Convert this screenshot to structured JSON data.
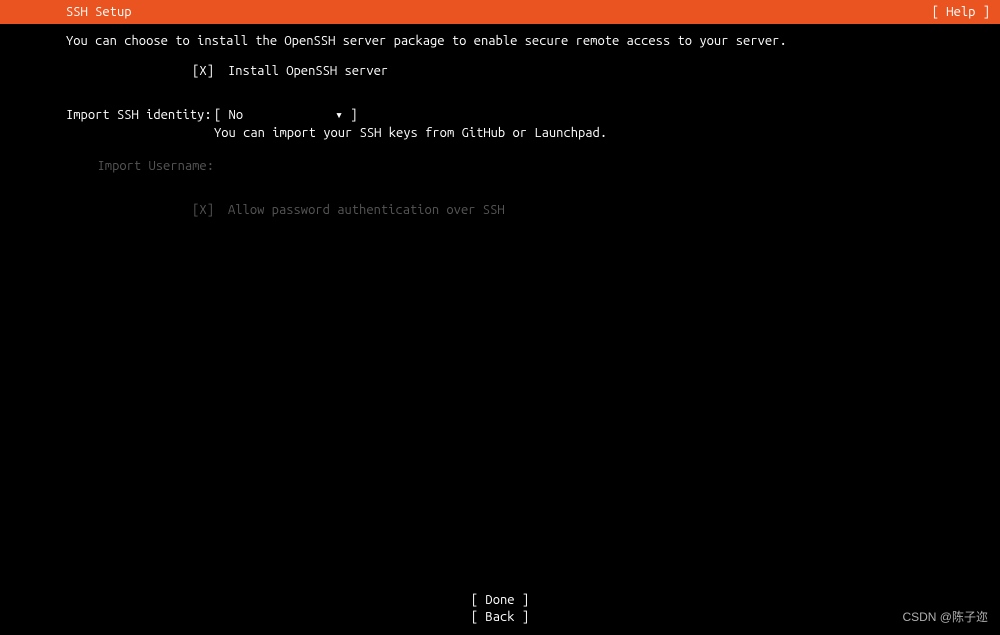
{
  "header": {
    "title": "SSH Setup",
    "help": "[ Help ]"
  },
  "intro": "You can choose to install the OpenSSH server package to enable secure remote access to your server.",
  "install_checkbox": {
    "mark": "[X]",
    "label": "Install OpenSSH server"
  },
  "import_identity": {
    "label": "Import SSH identity:",
    "value": "[ No",
    "arrow": "▾ ]",
    "hint": "You can import your SSH keys from GitHub or Launchpad."
  },
  "import_username": {
    "label": "Import Username:"
  },
  "allow_password": {
    "mark": "[X]",
    "label": "Allow password authentication over SSH"
  },
  "footer": {
    "done": "[ Done       ]",
    "back": "[ Back       ]"
  },
  "watermark": "CSDN @陈子迩",
  "faint": ""
}
